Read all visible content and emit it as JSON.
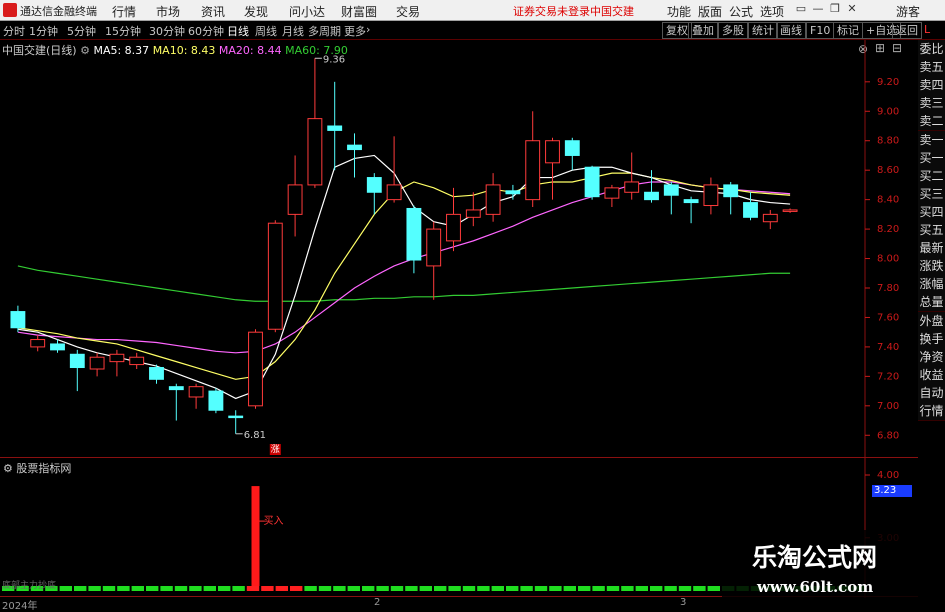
{
  "window": {
    "app_title": "通达信金融终端",
    "menus": [
      "行情",
      "市场",
      "资讯",
      "发现",
      "问小达",
      "财富圈",
      "交易"
    ],
    "status_left": "证券交易未登录",
    "status_right": "中国交建",
    "right_menus": [
      "功能",
      "版面",
      "公式",
      "选项"
    ],
    "guest": "游客"
  },
  "periods": [
    "分时",
    "1分钟",
    "5分钟",
    "15分钟",
    "30分钟",
    "60分钟",
    "日线",
    "周线",
    "月线",
    "多周期",
    "更多"
  ],
  "active_period": "日线",
  "tools": [
    "复权",
    "叠加",
    "多股",
    "统计",
    "画线",
    "F10",
    "标记",
    "+自选",
    "返回"
  ],
  "chart_info": {
    "title": "中国交建(日线)",
    "ma5": "MA5: 8.37",
    "ma10": "MA10: 8.43",
    "ma20": "MA20: 8.44",
    "ma60": "MA60: 7.90"
  },
  "colors": {
    "up": "#ff3b3b",
    "down": "#54ffff",
    "ma5": "#ffffff",
    "ma10": "#ffff66",
    "ma20": "#ff66ff",
    "ma60": "#33cc33",
    "axis": "#cc1a1a"
  },
  "y_ticks": [
    "9.20",
    "9.00",
    "8.80",
    "8.60",
    "8.40",
    "8.20",
    "8.00",
    "7.80",
    "7.60",
    "7.40",
    "7.20",
    "7.00",
    "6.80"
  ],
  "annotations": {
    "high": "9.36",
    "low": "6.81",
    "marker": "涨"
  },
  "side_panel": [
    "委比",
    "卖五",
    "卖四",
    "卖三",
    "卖二",
    "卖一",
    "买一",
    "买二",
    "买三",
    "买四",
    "买五",
    "最新",
    "涨跌",
    "涨幅",
    "总量",
    "外盘",
    "换手",
    "净资",
    "收益",
    "自动",
    "行情"
  ],
  "indicator": {
    "title": "股票指标网",
    "signal_label": "买入",
    "y_ticks": [
      "4.00",
      "3.23",
      "3.00"
    ],
    "current_value": "3.23",
    "lower_label": "底部主力抄底"
  },
  "x_labels": [
    "2024年",
    "2",
    "3"
  ],
  "watermark": {
    "title": "乐淘公式网",
    "url": "www.60lt.com"
  },
  "chart_data": {
    "type": "candlestick",
    "ylim": [
      6.7,
      9.45
    ],
    "candles": [
      {
        "o": 7.64,
        "c": 7.53,
        "h": 7.68,
        "l": 7.5
      },
      {
        "o": 7.4,
        "c": 7.45,
        "h": 7.48,
        "l": 7.37
      },
      {
        "o": 7.42,
        "c": 7.38,
        "h": 7.45,
        "l": 7.36
      },
      {
        "o": 7.35,
        "c": 7.26,
        "h": 7.38,
        "l": 7.1
      },
      {
        "o": 7.25,
        "c": 7.33,
        "h": 7.36,
        "l": 7.2
      },
      {
        "o": 7.3,
        "c": 7.35,
        "h": 7.38,
        "l": 7.2
      },
      {
        "o": 7.28,
        "c": 7.33,
        "h": 7.36,
        "l": 7.25
      },
      {
        "o": 7.26,
        "c": 7.18,
        "h": 7.28,
        "l": 7.15
      },
      {
        "o": 7.13,
        "c": 7.11,
        "h": 7.15,
        "l": 6.9
      },
      {
        "o": 7.06,
        "c": 7.13,
        "h": 7.15,
        "l": 6.98
      },
      {
        "o": 7.1,
        "c": 6.97,
        "h": 7.12,
        "l": 6.95
      },
      {
        "o": 6.93,
        "c": 6.92,
        "h": 6.97,
        "l": 6.81
      },
      {
        "o": 7.0,
        "c": 7.5,
        "h": 7.52,
        "l": 6.98
      },
      {
        "o": 7.52,
        "c": 8.24,
        "h": 8.26,
        "l": 7.5
      },
      {
        "o": 8.3,
        "c": 8.5,
        "h": 8.7,
        "l": 8.15
      },
      {
        "o": 8.5,
        "c": 8.95,
        "h": 9.36,
        "l": 8.48
      },
      {
        "o": 8.9,
        "c": 8.87,
        "h": 9.2,
        "l": 8.6
      },
      {
        "o": 8.77,
        "c": 8.74,
        "h": 8.85,
        "l": 8.55
      },
      {
        "o": 8.55,
        "c": 8.45,
        "h": 8.58,
        "l": 8.3
      },
      {
        "o": 8.4,
        "c": 8.5,
        "h": 8.83,
        "l": 8.38
      },
      {
        "o": 8.34,
        "c": 7.99,
        "h": 8.36,
        "l": 7.9
      },
      {
        "o": 7.95,
        "c": 8.2,
        "h": 8.25,
        "l": 7.72
      },
      {
        "o": 8.12,
        "c": 8.3,
        "h": 8.48,
        "l": 8.05
      },
      {
        "o": 8.28,
        "c": 8.33,
        "h": 8.45,
        "l": 8.22
      },
      {
        "o": 8.3,
        "c": 8.5,
        "h": 8.58,
        "l": 8.25
      },
      {
        "o": 8.46,
        "c": 8.44,
        "h": 8.5,
        "l": 8.4
      },
      {
        "o": 8.4,
        "c": 8.8,
        "h": 9.0,
        "l": 8.35
      },
      {
        "o": 8.65,
        "c": 8.8,
        "h": 8.82,
        "l": 8.4
      },
      {
        "o": 8.8,
        "c": 8.7,
        "h": 8.82,
        "l": 8.6
      },
      {
        "o": 8.62,
        "c": 8.42,
        "h": 8.63,
        "l": 8.4
      },
      {
        "o": 8.41,
        "c": 8.48,
        "h": 8.5,
        "l": 8.35
      },
      {
        "o": 8.45,
        "c": 8.52,
        "h": 8.72,
        "l": 8.4
      },
      {
        "o": 8.45,
        "c": 8.4,
        "h": 8.6,
        "l": 8.38
      },
      {
        "o": 8.5,
        "c": 8.43,
        "h": 8.52,
        "l": 8.3
      },
      {
        "o": 8.4,
        "c": 8.38,
        "h": 8.42,
        "l": 8.24
      },
      {
        "o": 8.36,
        "c": 8.5,
        "h": 8.55,
        "l": 8.3
      },
      {
        "o": 8.5,
        "c": 8.42,
        "h": 8.52,
        "l": 8.3
      },
      {
        "o": 8.38,
        "c": 8.28,
        "h": 8.45,
        "l": 8.26
      },
      {
        "o": 8.25,
        "c": 8.3,
        "h": 8.33,
        "l": 8.2
      },
      {
        "o": 8.32,
        "c": 8.33,
        "h": 8.34,
        "l": 8.31
      }
    ],
    "ma5": [
      7.52,
      7.5,
      7.45,
      7.4,
      7.36,
      7.33,
      7.3,
      7.27,
      7.22,
      7.17,
      7.12,
      7.05,
      7.1,
      7.35,
      7.75,
      8.2,
      8.62,
      8.68,
      8.7,
      8.58,
      8.35,
      8.25,
      8.22,
      8.3,
      8.38,
      8.42,
      8.55,
      8.55,
      8.6,
      8.62,
      8.62,
      8.58,
      8.55,
      8.5,
      8.46,
      8.45,
      8.44,
      8.4,
      8.38,
      8.37
    ],
    "ma10": [
      7.53,
      7.51,
      7.49,
      7.46,
      7.44,
      7.42,
      7.38,
      7.34,
      7.3,
      7.26,
      7.22,
      7.18,
      7.2,
      7.3,
      7.45,
      7.65,
      7.9,
      8.1,
      8.3,
      8.45,
      8.52,
      8.48,
      8.42,
      8.43,
      8.47,
      8.45,
      8.5,
      8.52,
      8.52,
      8.55,
      8.58,
      8.58,
      8.55,
      8.53,
      8.5,
      8.48,
      8.47,
      8.45,
      8.44,
      8.43
    ],
    "ma20": [
      7.5,
      7.48,
      7.47,
      7.46,
      7.45,
      7.45,
      7.44,
      7.43,
      7.41,
      7.39,
      7.37,
      7.36,
      7.37,
      7.42,
      7.5,
      7.6,
      7.7,
      7.8,
      7.88,
      7.95,
      8.0,
      8.04,
      8.08,
      8.12,
      8.17,
      8.22,
      8.28,
      8.33,
      8.38,
      8.42,
      8.46,
      8.5,
      8.52,
      8.52,
      8.5,
      8.48,
      8.47,
      8.46,
      8.45,
      8.44
    ],
    "ma60": [
      7.95,
      7.92,
      7.9,
      7.88,
      7.86,
      7.84,
      7.82,
      7.8,
      7.78,
      7.76,
      7.74,
      7.72,
      7.71,
      7.71,
      7.71,
      7.71,
      7.72,
      7.72,
      7.73,
      7.73,
      7.74,
      7.74,
      7.75,
      7.75,
      7.76,
      7.77,
      7.78,
      7.79,
      7.8,
      7.81,
      7.82,
      7.83,
      7.84,
      7.85,
      7.86,
      7.87,
      7.88,
      7.89,
      7.9,
      7.9
    ],
    "signal_index": 12,
    "signal_pct": 0.9
  }
}
